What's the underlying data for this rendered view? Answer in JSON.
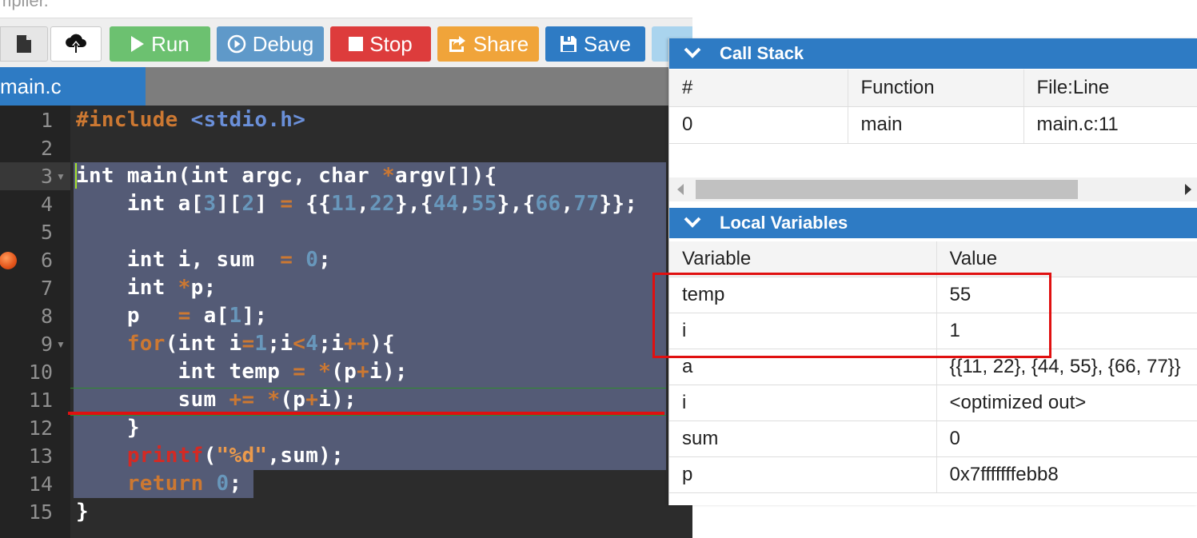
{
  "app": {
    "title_fragment": "mpiler."
  },
  "toolbar": {
    "run_label": "Run",
    "debug_label": "Debug",
    "stop_label": "Stop",
    "share_label": "Share",
    "save_label": "Save"
  },
  "tabs": [
    {
      "label": "main.c"
    }
  ],
  "editor": {
    "line_numbers": [
      "1",
      "2",
      "3",
      "4",
      "5",
      "6",
      "7",
      "8",
      "9",
      "10",
      "11",
      "12",
      "13",
      "14",
      "15"
    ],
    "breakpoint_line": 6,
    "current_line": 11
  },
  "call_stack": {
    "title": "Call Stack",
    "columns": [
      "#",
      "Function",
      "File:Line"
    ],
    "rows": [
      {
        "index": "0",
        "function": "main",
        "location": "main.c:11"
      }
    ]
  },
  "locals": {
    "title": "Local Variables",
    "columns": [
      "Variable",
      "Value"
    ],
    "rows": [
      {
        "name": "temp",
        "value": "55"
      },
      {
        "name": "i",
        "value": "1"
      },
      {
        "name": "a",
        "value": "{{11, 22}, {44, 55}, {66, 77}}"
      },
      {
        "name": "i",
        "value": "<optimized out>"
      },
      {
        "name": "sum",
        "value": "0"
      },
      {
        "name": "p",
        "value": "0x7fffffffebb8"
      }
    ]
  },
  "colors": {
    "run": "#6cc170",
    "debug": "#5f99c9",
    "stop": "#dd3c3c",
    "share": "#f0a43a",
    "save": "#2e7bc4",
    "annotation": "#e01010"
  }
}
